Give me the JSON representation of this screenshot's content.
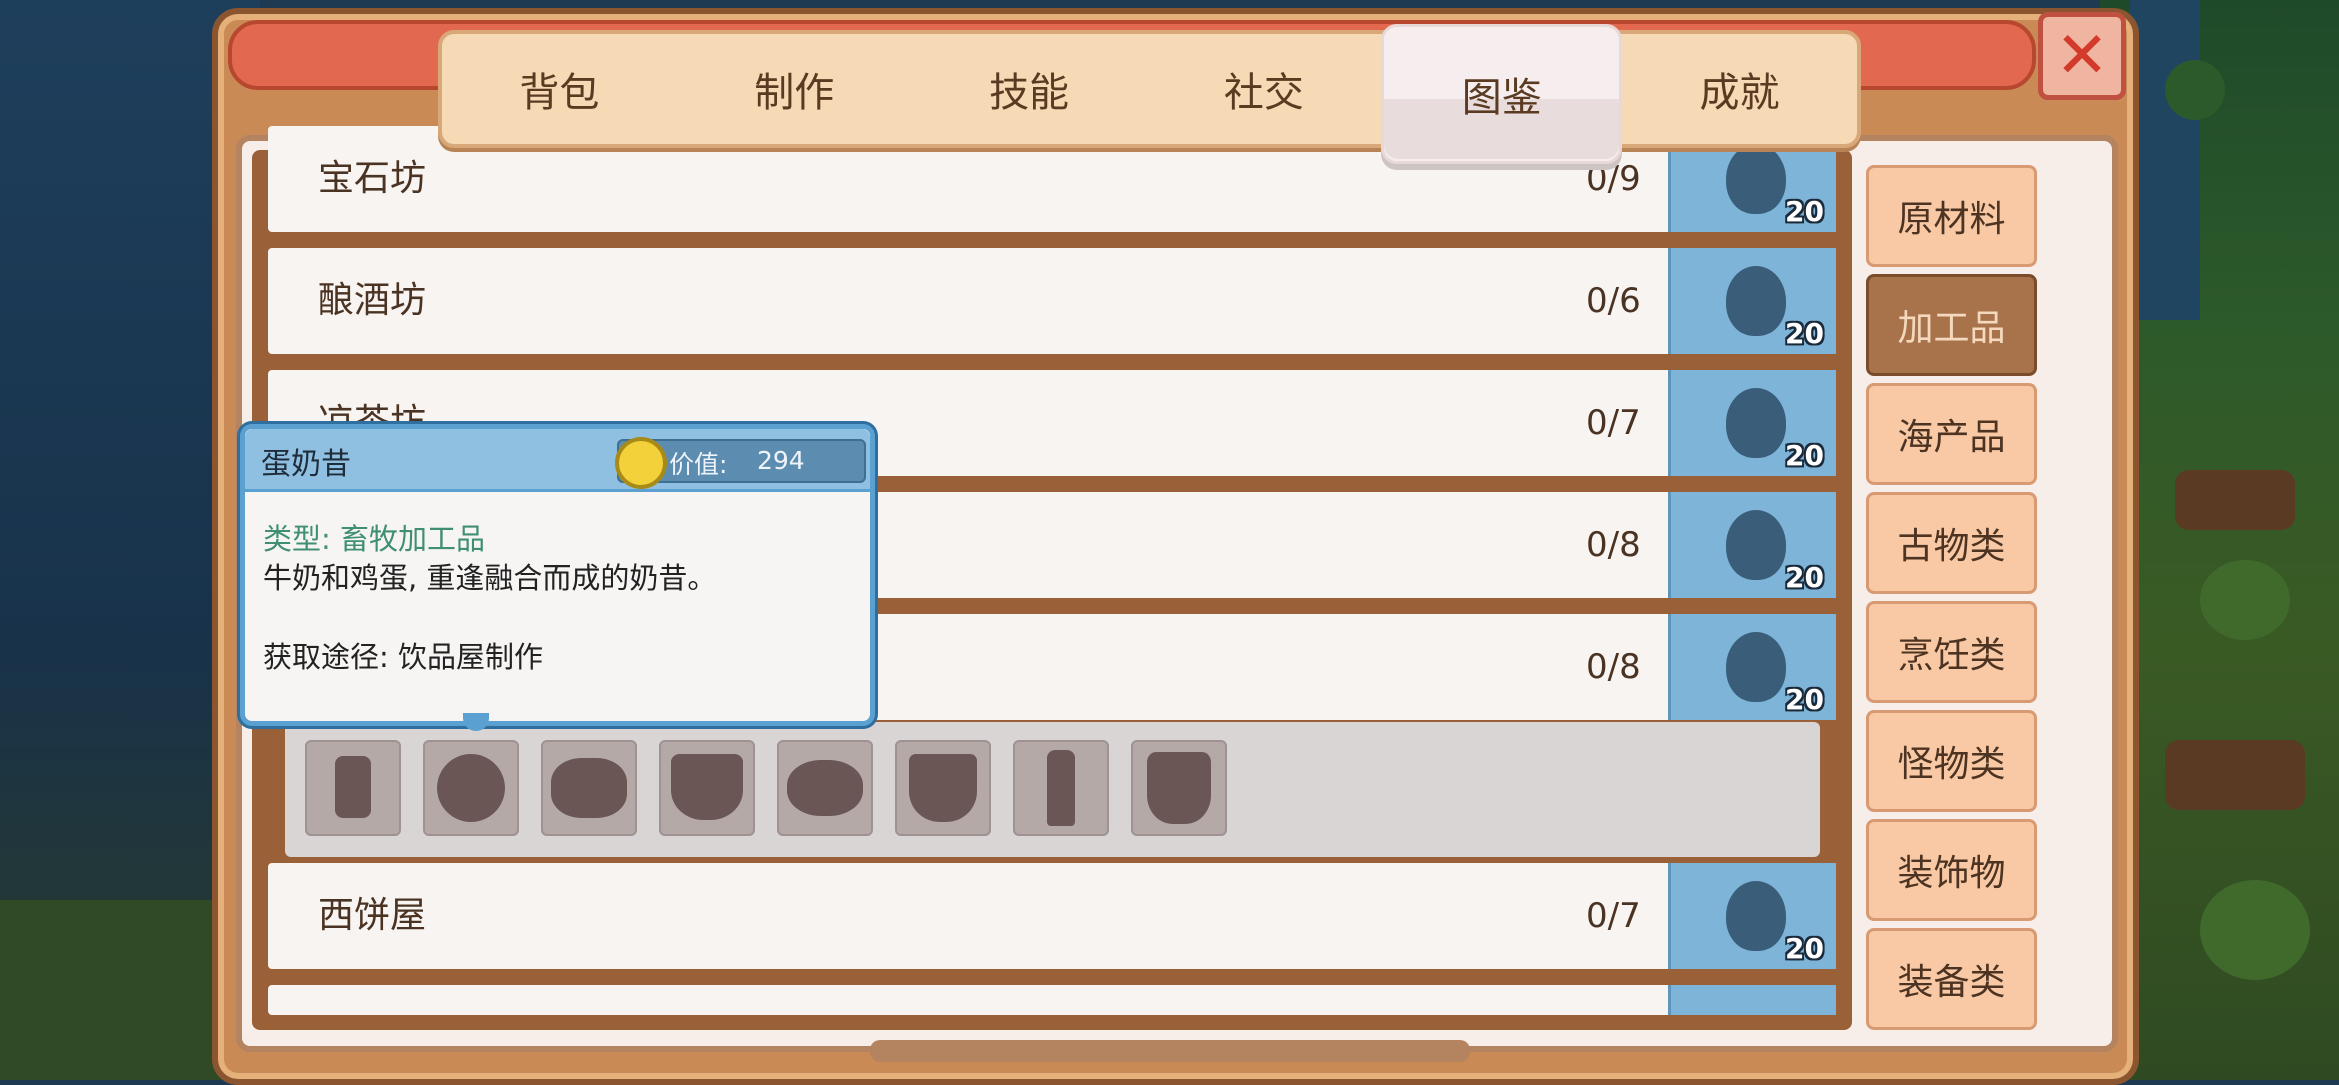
{
  "tabs": [
    {
      "label": "背包"
    },
    {
      "label": "制作"
    },
    {
      "label": "技能"
    },
    {
      "label": "社交"
    },
    {
      "label": "图鉴"
    },
    {
      "label": "成就"
    }
  ],
  "active_tab": "图鉴",
  "close_icon": "close-icon",
  "categories": [
    {
      "label": "原材料"
    },
    {
      "label": "加工品"
    },
    {
      "label": "海产品"
    },
    {
      "label": "古物类"
    },
    {
      "label": "烹饪类"
    },
    {
      "label": "怪物类"
    },
    {
      "label": "装饰物"
    },
    {
      "label": "装备类"
    }
  ],
  "active_category": "加工品",
  "rows": [
    {
      "name": "宝石坊",
      "count": "0/9",
      "reward": "20"
    },
    {
      "name": "酿酒坊",
      "count": "0/6",
      "reward": "20"
    },
    {
      "name": "凉茶坊",
      "count": "0/7",
      "reward": "20"
    },
    {
      "name": "",
      "count": "0/8",
      "reward": "20"
    },
    {
      "name": "",
      "count": "0/8",
      "reward": "20"
    },
    {
      "name": "西饼屋",
      "count": "0/7",
      "reward": "20"
    },
    {
      "name": "",
      "count": "",
      "reward": ""
    }
  ],
  "tooltip": {
    "title": "蛋奶昔",
    "price_label": "价值:",
    "price_value": "294",
    "type_line": "类型: 畜牧加工品",
    "description": "牛奶和鸡蛋, 重逢融合而成的奶昔。",
    "source_line": "获取途径: 饮品屋制作"
  },
  "colors": {
    "frame": "#c98a55",
    "title_strip": "#e2684f",
    "reward_blue": "#7eb4d8",
    "tooltip_border": "#5aa0d0",
    "active_category": "#a8734a"
  }
}
